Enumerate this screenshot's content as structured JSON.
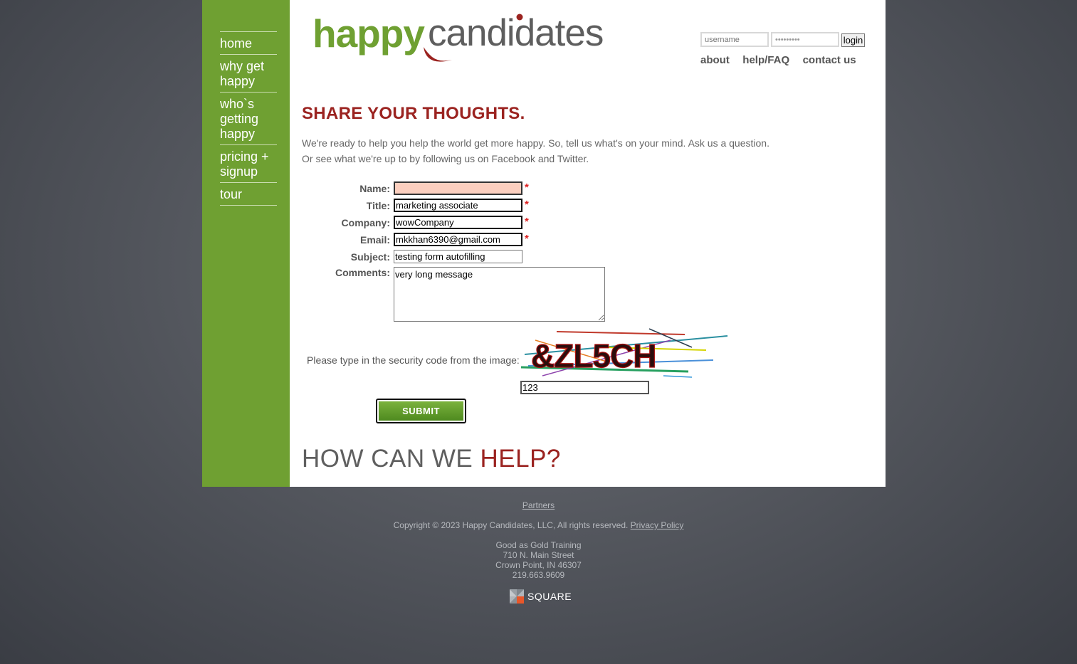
{
  "logo": {
    "word1": "happy",
    "word2": "candidates"
  },
  "nav": {
    "items": [
      {
        "label": "home"
      },
      {
        "label": "why get happy"
      },
      {
        "label": "who`s getting happy"
      },
      {
        "label": "pricing + signup"
      },
      {
        "label": "tour"
      }
    ]
  },
  "login": {
    "username_placeholder": "username",
    "password_value": "password1",
    "button": "login"
  },
  "toplinks": {
    "about": "about",
    "help": "help/FAQ",
    "contact": "contact us"
  },
  "heading": "SHARE YOUR THOUGHTS.",
  "intro": {
    "line1": "We're ready to help you help the world get more happy. So, tell us what's on your mind. Ask us a question.",
    "line2": "Or see what we're up to by following us on Facebook and Twitter."
  },
  "form": {
    "required_mark": "*",
    "name": {
      "label": "Name:",
      "value": ""
    },
    "title": {
      "label": "Title:",
      "value": "marketing associate"
    },
    "company": {
      "label": "Company:",
      "value": "wowCompany"
    },
    "email": {
      "label": "Email:",
      "value": "mkkhan6390@gmail.com"
    },
    "subject": {
      "label": "Subject:",
      "value": "testing form autofilling"
    },
    "comments": {
      "label": "Comments:",
      "value": "very long message"
    },
    "security_label": "Please type in the security code from the image:",
    "captcha_text": "&ZL5CH",
    "security_value": "123",
    "submit": "SUBMIT"
  },
  "help_heading": {
    "part1": "HOW CAN WE",
    "part2": "HELP?"
  },
  "footer": {
    "partners": "Partners",
    "copyright": "Copyright © 2023 Happy Candidates, LLC, All rights reserved.",
    "privacy": "Privacy Policy",
    "address": [
      "Good as Gold Training",
      "710 N. Main Street",
      "Crown Point, IN 46307",
      "219.663.9609"
    ],
    "square": "SQUARE"
  },
  "colors": {
    "sidebar_green": "#6fa032",
    "heading_red": "#9b2320",
    "text_gray": "#666666"
  }
}
